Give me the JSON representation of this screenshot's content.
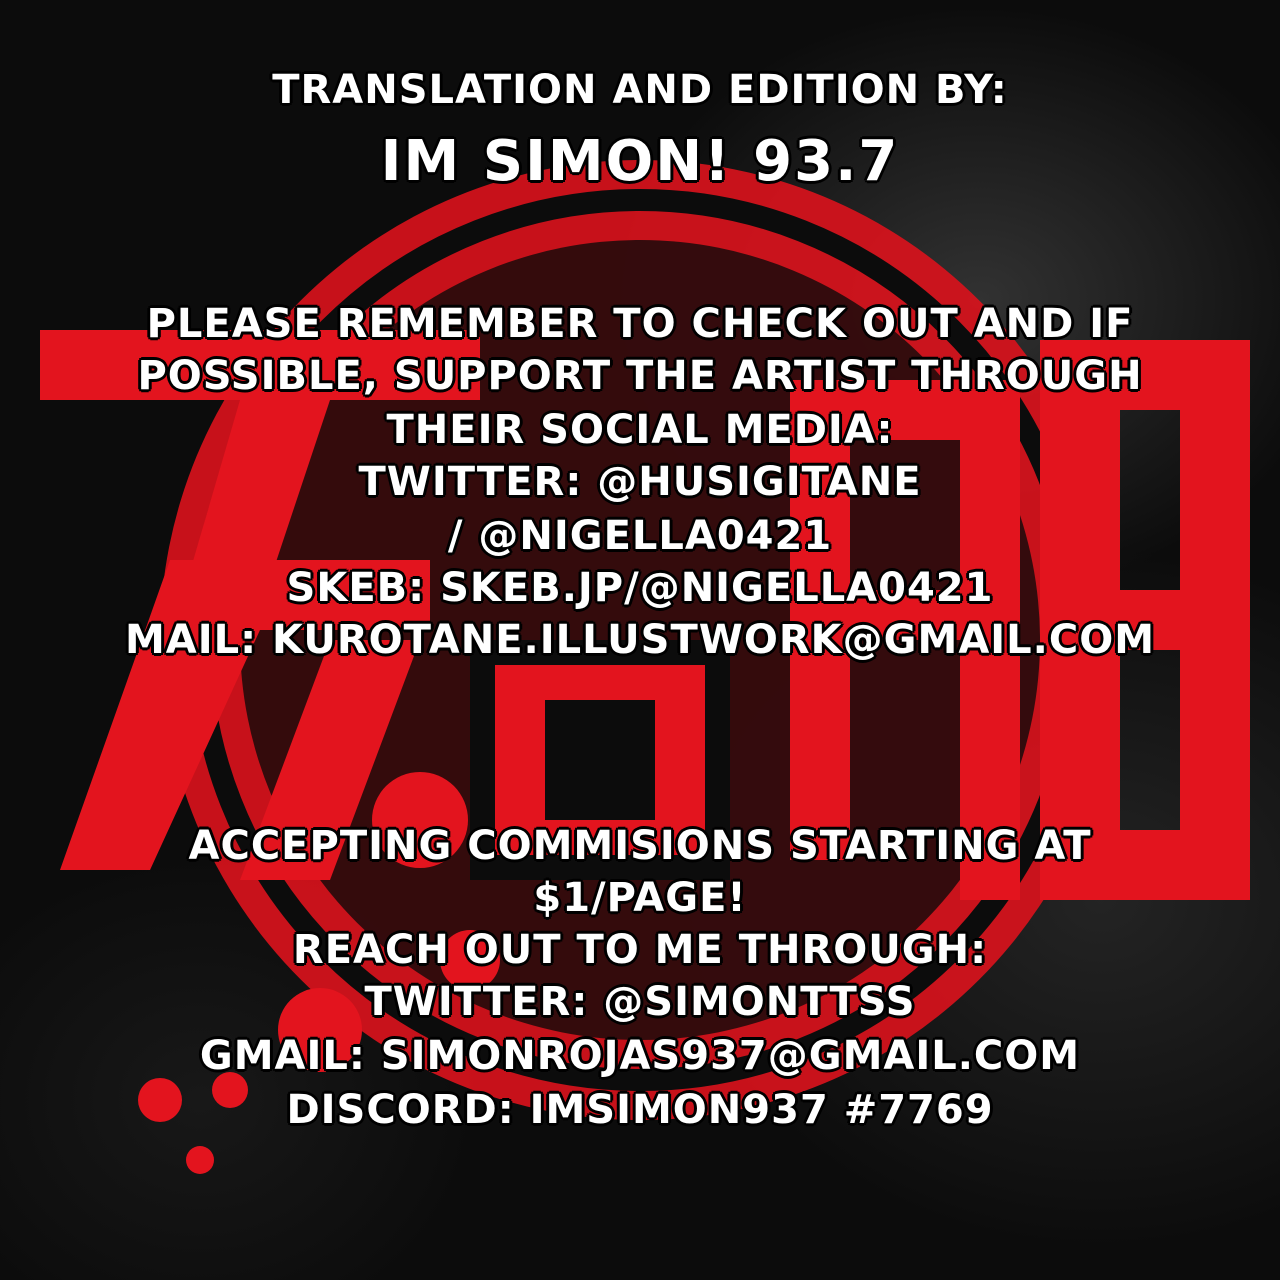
{
  "colors": {
    "background": "#0c0c0c",
    "logo_red": "#e3141e",
    "text": "#ffffff",
    "outline": "#000000"
  },
  "credits": {
    "heading": "TRANSLATION AND EDITION BY:",
    "name": "IM SIMON! 93.7"
  },
  "artist_section": {
    "lines": [
      "PLEASE REMEMBER TO CHECK OUT AND IF",
      "POSSIBLE, SUPPORT THE ARTIST THROUGH",
      "THEIR SOCIAL MEDIA:",
      "TWITTER: @HUSIGITANE",
      "/ @NIGELLA0421",
      "SKEB: SKEB.JP/@NIGELLA0421",
      "MAIL: KUROTANE.ILLUSTWORK@GMAIL.COM"
    ]
  },
  "commission_section": {
    "lines": [
      "ACCEPTING COMMISIONS STARTING AT",
      "$1/PAGE!",
      "REACH OUT TO ME THROUGH:",
      "TWITTER: @SIMONTTSS",
      "GMAIL: SIMONROJAS937@GMAIL.COM",
      "DISCORD: IMSIMON937 #7769"
    ]
  },
  "background_art": {
    "icon": "red-circle-logo-with-kanji"
  }
}
